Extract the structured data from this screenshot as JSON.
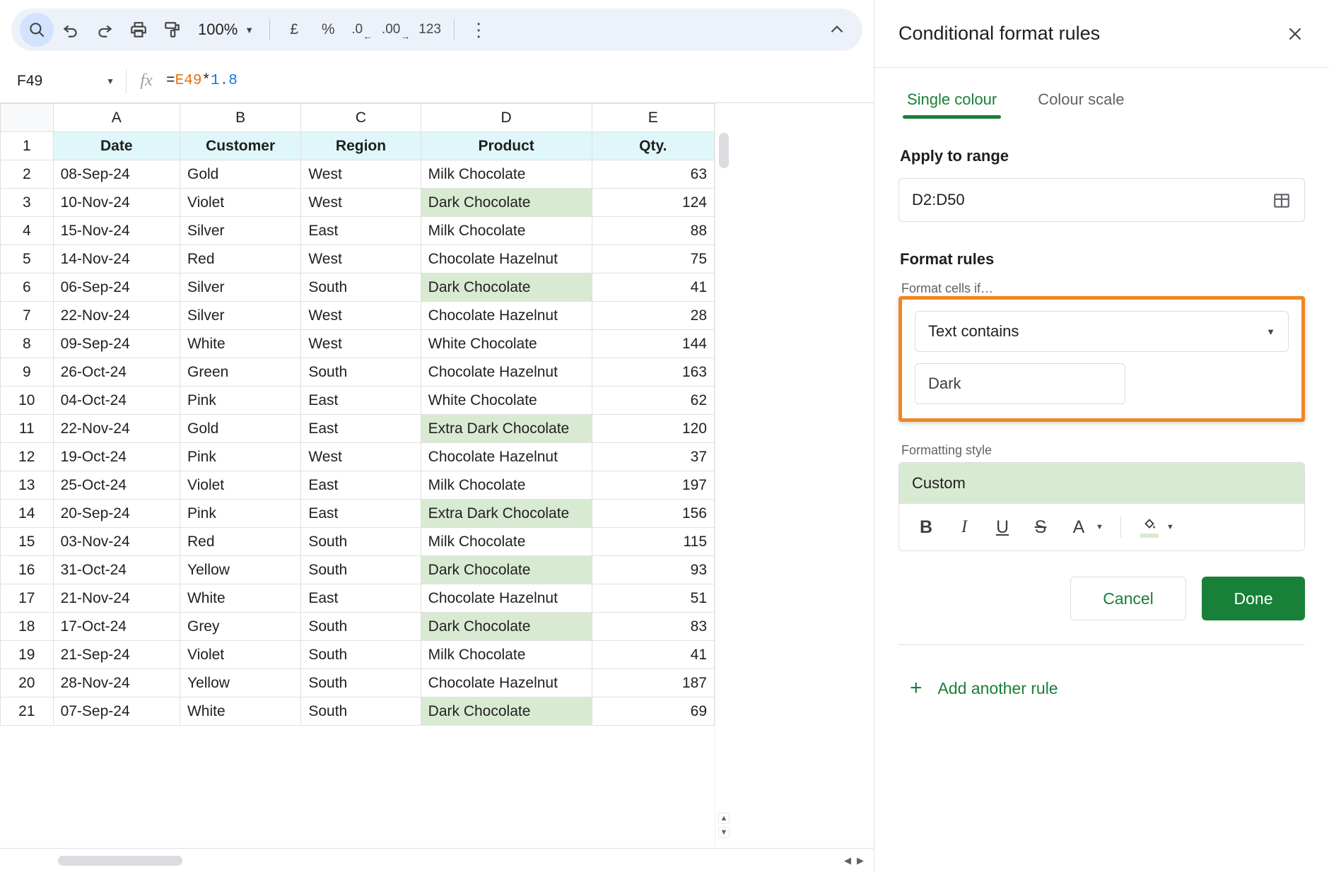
{
  "toolbar": {
    "search_icon": "search-icon",
    "undo_icon": "undo-icon",
    "redo_icon": "redo-icon",
    "print_icon": "print-icon",
    "paint_format_icon": "paint-format-icon",
    "zoom_value": "100%",
    "currency_label": "£",
    "percent_label": "%",
    "decrease_decimal_label": ".0",
    "increase_decimal_label": ".00",
    "number_format_label": "123",
    "more_icon": "more-vert-icon",
    "collapse_icon": "chevron-up-icon"
  },
  "formula_bar": {
    "name_box": "F49",
    "fx_label": "fx",
    "formula_prefix": "=",
    "formula_ref": "E49",
    "formula_op": "*",
    "formula_num": "1.8"
  },
  "sheet": {
    "column_headers": [
      "A",
      "B",
      "C",
      "D",
      "E"
    ],
    "header_row": [
      "Date",
      "Customer",
      "Region",
      "Product",
      "Qty."
    ],
    "rows": [
      {
        "n": "2",
        "date": "08-Sep-24",
        "customer": "Gold",
        "region": "West",
        "product": "Milk Chocolate",
        "qty": "63",
        "hl": false
      },
      {
        "n": "3",
        "date": "10-Nov-24",
        "customer": "Violet",
        "region": "West",
        "product": "Dark Chocolate",
        "qty": "124",
        "hl": true
      },
      {
        "n": "4",
        "date": "15-Nov-24",
        "customer": "Silver",
        "region": "East",
        "product": "Milk Chocolate",
        "qty": "88",
        "hl": false
      },
      {
        "n": "5",
        "date": "14-Nov-24",
        "customer": "Red",
        "region": "West",
        "product": "Chocolate Hazelnut",
        "qty": "75",
        "hl": false
      },
      {
        "n": "6",
        "date": "06-Sep-24",
        "customer": "Silver",
        "region": "South",
        "product": "Dark Chocolate",
        "qty": "41",
        "hl": true
      },
      {
        "n": "7",
        "date": "22-Nov-24",
        "customer": "Silver",
        "region": "West",
        "product": "Chocolate Hazelnut",
        "qty": "28",
        "hl": false
      },
      {
        "n": "8",
        "date": "09-Sep-24",
        "customer": "White",
        "region": "West",
        "product": "White Chocolate",
        "qty": "144",
        "hl": false
      },
      {
        "n": "9",
        "date": "26-Oct-24",
        "customer": "Green",
        "region": "South",
        "product": "Chocolate Hazelnut",
        "qty": "163",
        "hl": false
      },
      {
        "n": "10",
        "date": "04-Oct-24",
        "customer": "Pink",
        "region": "East",
        "product": "White Chocolate",
        "qty": "62",
        "hl": false
      },
      {
        "n": "11",
        "date": "22-Nov-24",
        "customer": "Gold",
        "region": "East",
        "product": "Extra Dark Chocolate",
        "qty": "120",
        "hl": true
      },
      {
        "n": "12",
        "date": "19-Oct-24",
        "customer": "Pink",
        "region": "West",
        "product": "Chocolate Hazelnut",
        "qty": "37",
        "hl": false
      },
      {
        "n": "13",
        "date": "25-Oct-24",
        "customer": "Violet",
        "region": "East",
        "product": "Milk Chocolate",
        "qty": "197",
        "hl": false
      },
      {
        "n": "14",
        "date": "20-Sep-24",
        "customer": "Pink",
        "region": "East",
        "product": "Extra Dark Chocolate",
        "qty": "156",
        "hl": true
      },
      {
        "n": "15",
        "date": "03-Nov-24",
        "customer": "Red",
        "region": "South",
        "product": "Milk Chocolate",
        "qty": "115",
        "hl": false
      },
      {
        "n": "16",
        "date": "31-Oct-24",
        "customer": "Yellow",
        "region": "South",
        "product": "Dark Chocolate",
        "qty": "93",
        "hl": true
      },
      {
        "n": "17",
        "date": "21-Nov-24",
        "customer": "White",
        "region": "East",
        "product": "Chocolate Hazelnut",
        "qty": "51",
        "hl": false
      },
      {
        "n": "18",
        "date": "17-Oct-24",
        "customer": "Grey",
        "region": "South",
        "product": "Dark Chocolate",
        "qty": "83",
        "hl": true
      },
      {
        "n": "19",
        "date": "21-Sep-24",
        "customer": "Violet",
        "region": "South",
        "product": "Milk Chocolate",
        "qty": "41",
        "hl": false
      },
      {
        "n": "20",
        "date": "28-Nov-24",
        "customer": "Yellow",
        "region": "South",
        "product": "Chocolate Hazelnut",
        "qty": "187",
        "hl": false
      },
      {
        "n": "21",
        "date": "07-Sep-24",
        "customer": "White",
        "region": "South",
        "product": "Dark Chocolate",
        "qty": "69",
        "hl": true
      }
    ]
  },
  "panel": {
    "title": "Conditional format rules",
    "close_icon": "close-icon",
    "tabs": [
      {
        "label": "Single colour",
        "selected": true
      },
      {
        "label": "Colour scale",
        "selected": false
      }
    ],
    "apply_to_range_label": "Apply to range",
    "range_value": "D2:D50",
    "range_picker_icon": "grid-select-icon",
    "format_rules_label": "Format rules",
    "format_cells_if_label": "Format cells if…",
    "condition_value": "Text contains",
    "condition_caret_icon": "chevron-down-icon",
    "condition_text_value": "Dark",
    "formatting_style_label": "Formatting style",
    "style_preview_label": "Custom",
    "style_tools": {
      "bold": "B",
      "italic": "I",
      "underline": "U",
      "strikethrough": "S",
      "text_colour": "A",
      "fill_colour_icon": "fill-colour-icon"
    },
    "cancel_label": "Cancel",
    "done_label": "Done",
    "add_rule_plus": "+",
    "add_rule_label": "Add another rule"
  },
  "colours": {
    "accent_green": "#188038",
    "highlight_orange": "#f08722",
    "header_fill": "#e0f7fa",
    "cell_highlight": "#d9ead3"
  }
}
